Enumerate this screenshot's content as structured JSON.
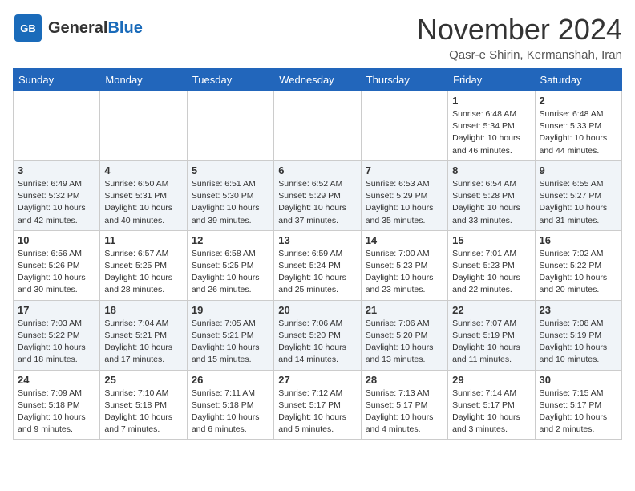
{
  "header": {
    "logo_general": "General",
    "logo_blue": "Blue",
    "month_title": "November 2024",
    "location": "Qasr-e Shirin, Kermanshah, Iran"
  },
  "days_of_week": [
    "Sunday",
    "Monday",
    "Tuesday",
    "Wednesday",
    "Thursday",
    "Friday",
    "Saturday"
  ],
  "weeks": [
    [
      {
        "day": "",
        "info": ""
      },
      {
        "day": "",
        "info": ""
      },
      {
        "day": "",
        "info": ""
      },
      {
        "day": "",
        "info": ""
      },
      {
        "day": "",
        "info": ""
      },
      {
        "day": "1",
        "info": "Sunrise: 6:48 AM\nSunset: 5:34 PM\nDaylight: 10 hours and 46 minutes."
      },
      {
        "day": "2",
        "info": "Sunrise: 6:48 AM\nSunset: 5:33 PM\nDaylight: 10 hours and 44 minutes."
      }
    ],
    [
      {
        "day": "3",
        "info": "Sunrise: 6:49 AM\nSunset: 5:32 PM\nDaylight: 10 hours and 42 minutes."
      },
      {
        "day": "4",
        "info": "Sunrise: 6:50 AM\nSunset: 5:31 PM\nDaylight: 10 hours and 40 minutes."
      },
      {
        "day": "5",
        "info": "Sunrise: 6:51 AM\nSunset: 5:30 PM\nDaylight: 10 hours and 39 minutes."
      },
      {
        "day": "6",
        "info": "Sunrise: 6:52 AM\nSunset: 5:29 PM\nDaylight: 10 hours and 37 minutes."
      },
      {
        "day": "7",
        "info": "Sunrise: 6:53 AM\nSunset: 5:29 PM\nDaylight: 10 hours and 35 minutes."
      },
      {
        "day": "8",
        "info": "Sunrise: 6:54 AM\nSunset: 5:28 PM\nDaylight: 10 hours and 33 minutes."
      },
      {
        "day": "9",
        "info": "Sunrise: 6:55 AM\nSunset: 5:27 PM\nDaylight: 10 hours and 31 minutes."
      }
    ],
    [
      {
        "day": "10",
        "info": "Sunrise: 6:56 AM\nSunset: 5:26 PM\nDaylight: 10 hours and 30 minutes."
      },
      {
        "day": "11",
        "info": "Sunrise: 6:57 AM\nSunset: 5:25 PM\nDaylight: 10 hours and 28 minutes."
      },
      {
        "day": "12",
        "info": "Sunrise: 6:58 AM\nSunset: 5:25 PM\nDaylight: 10 hours and 26 minutes."
      },
      {
        "day": "13",
        "info": "Sunrise: 6:59 AM\nSunset: 5:24 PM\nDaylight: 10 hours and 25 minutes."
      },
      {
        "day": "14",
        "info": "Sunrise: 7:00 AM\nSunset: 5:23 PM\nDaylight: 10 hours and 23 minutes."
      },
      {
        "day": "15",
        "info": "Sunrise: 7:01 AM\nSunset: 5:23 PM\nDaylight: 10 hours and 22 minutes."
      },
      {
        "day": "16",
        "info": "Sunrise: 7:02 AM\nSunset: 5:22 PM\nDaylight: 10 hours and 20 minutes."
      }
    ],
    [
      {
        "day": "17",
        "info": "Sunrise: 7:03 AM\nSunset: 5:22 PM\nDaylight: 10 hours and 18 minutes."
      },
      {
        "day": "18",
        "info": "Sunrise: 7:04 AM\nSunset: 5:21 PM\nDaylight: 10 hours and 17 minutes."
      },
      {
        "day": "19",
        "info": "Sunrise: 7:05 AM\nSunset: 5:21 PM\nDaylight: 10 hours and 15 minutes."
      },
      {
        "day": "20",
        "info": "Sunrise: 7:06 AM\nSunset: 5:20 PM\nDaylight: 10 hours and 14 minutes."
      },
      {
        "day": "21",
        "info": "Sunrise: 7:06 AM\nSunset: 5:20 PM\nDaylight: 10 hours and 13 minutes."
      },
      {
        "day": "22",
        "info": "Sunrise: 7:07 AM\nSunset: 5:19 PM\nDaylight: 10 hours and 11 minutes."
      },
      {
        "day": "23",
        "info": "Sunrise: 7:08 AM\nSunset: 5:19 PM\nDaylight: 10 hours and 10 minutes."
      }
    ],
    [
      {
        "day": "24",
        "info": "Sunrise: 7:09 AM\nSunset: 5:18 PM\nDaylight: 10 hours and 9 minutes."
      },
      {
        "day": "25",
        "info": "Sunrise: 7:10 AM\nSunset: 5:18 PM\nDaylight: 10 hours and 7 minutes."
      },
      {
        "day": "26",
        "info": "Sunrise: 7:11 AM\nSunset: 5:18 PM\nDaylight: 10 hours and 6 minutes."
      },
      {
        "day": "27",
        "info": "Sunrise: 7:12 AM\nSunset: 5:17 PM\nDaylight: 10 hours and 5 minutes."
      },
      {
        "day": "28",
        "info": "Sunrise: 7:13 AM\nSunset: 5:17 PM\nDaylight: 10 hours and 4 minutes."
      },
      {
        "day": "29",
        "info": "Sunrise: 7:14 AM\nSunset: 5:17 PM\nDaylight: 10 hours and 3 minutes."
      },
      {
        "day": "30",
        "info": "Sunrise: 7:15 AM\nSunset: 5:17 PM\nDaylight: 10 hours and 2 minutes."
      }
    ]
  ]
}
